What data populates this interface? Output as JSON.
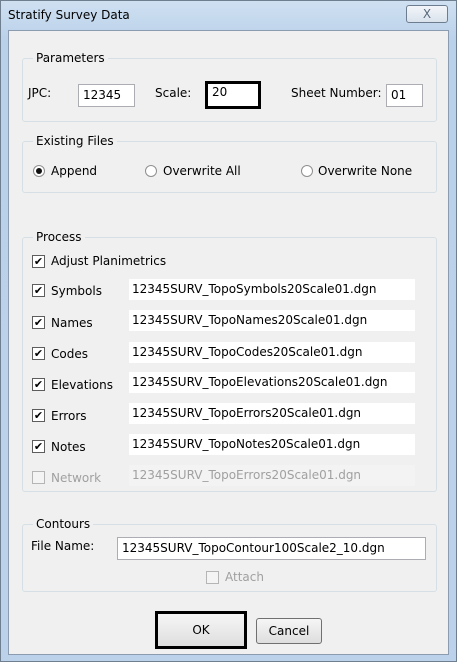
{
  "window": {
    "title": "Stratify Survey Data",
    "close_glyph": "X"
  },
  "parameters": {
    "legend": "Parameters",
    "jpc_label": "JPC:",
    "jpc_value": "12345",
    "scale_label": "Scale:",
    "scale_value": "20",
    "sheet_label": "Sheet Number:",
    "sheet_value": "01"
  },
  "existing_files": {
    "legend": "Existing Files",
    "options": [
      {
        "label": "Append",
        "checked": true
      },
      {
        "label": "Overwrite All",
        "checked": false
      },
      {
        "label": "Overwrite None",
        "checked": false
      }
    ]
  },
  "process": {
    "legend": "Process",
    "adjust_label": "Adjust Planimetrics",
    "items": [
      {
        "label": "Symbols",
        "file": "12345SURV_TopoSymbols20Scale01.dgn",
        "checked": true,
        "enabled": true
      },
      {
        "label": "Names",
        "file": "12345SURV_TopoNames20Scale01.dgn",
        "checked": true,
        "enabled": true
      },
      {
        "label": "Codes",
        "file": "12345SURV_TopoCodes20Scale01.dgn",
        "checked": true,
        "enabled": true
      },
      {
        "label": "Elevations",
        "file": "12345SURV_TopoElevations20Scale01.dgn",
        "checked": true,
        "enabled": true
      },
      {
        "label": "Errors",
        "file": "12345SURV_TopoErrors20Scale01.dgn",
        "checked": true,
        "enabled": true
      },
      {
        "label": "Notes",
        "file": "12345SURV_TopoNotes20Scale01.dgn",
        "checked": true,
        "enabled": true
      },
      {
        "label": "Network",
        "file": "12345SURV_TopoErrors20Scale01.dgn",
        "checked": false,
        "enabled": false
      }
    ]
  },
  "contours": {
    "legend": "Contours",
    "file_label": "File Name:",
    "file_value": "12345SURV_TopoContour100Scale2_10.dgn",
    "attach_label": "Attach"
  },
  "buttons": {
    "ok": "OK",
    "cancel": "Cancel"
  },
  "glyphs": {
    "check": "✔"
  }
}
